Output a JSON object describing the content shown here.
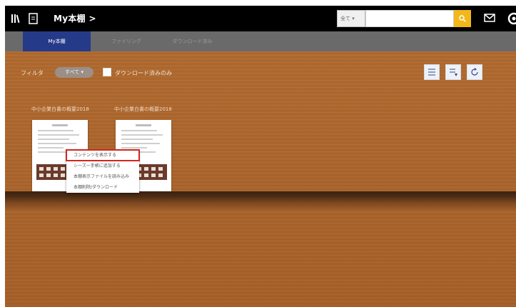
{
  "header": {
    "title": "My本棚 >",
    "icons": [
      "library-icon",
      "document-icon",
      "mail-icon",
      "gear-icon"
    ],
    "search": {
      "scope": "全て ▾",
      "placeholder": "",
      "button_color": "#f2b71a"
    }
  },
  "tabs": [
    {
      "label": "My本棚",
      "active": true
    },
    {
      "label": "ファイリング",
      "active": false
    },
    {
      "label": "ダウンロード済み",
      "active": false
    }
  ],
  "filter": {
    "label": "フィルタ",
    "value": "すべて ▾",
    "download_label": "ダウンロード済みのみ",
    "download_checked": false
  },
  "view_controls": [
    "list-view-icon",
    "sort-view-icon",
    "refresh-icon"
  ],
  "books": [
    {
      "title": "中小企業白書の概要2018"
    },
    {
      "title": "中小企業白書の概要2018"
    }
  ],
  "context_menu": {
    "items": [
      "コンテンツを表示する",
      "シーズー手帳に追加する",
      "本棚表示ファイルを読み込み",
      "本棚削除/ダウンロード"
    ],
    "highlighted_index": 0,
    "highlight_color": "#d3261f"
  },
  "colors": {
    "topbar": "#000000",
    "tabbar": "#6a6a6a",
    "active_tab": "#263a8a",
    "wood": "#a65f28"
  }
}
